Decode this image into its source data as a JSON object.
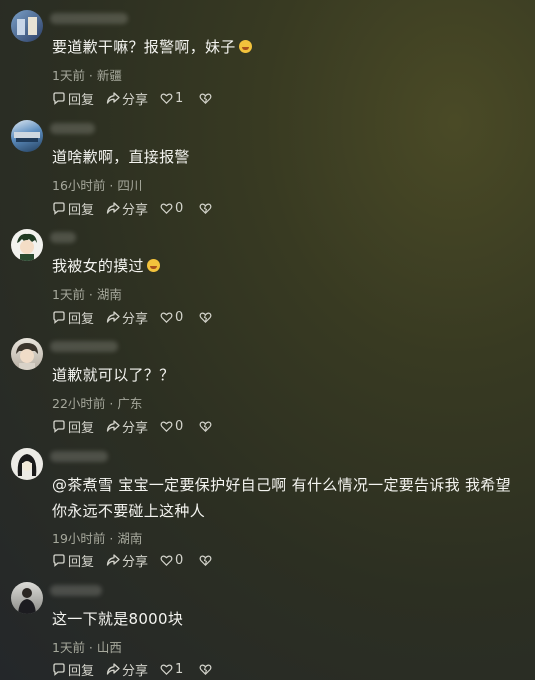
{
  "comments": [
    {
      "text": "要道歉干嘛？报警啊，妹子",
      "emoji": "laughing-emoji",
      "meta": "1天前 · 新疆",
      "reply": "回复",
      "share": "分享",
      "likes": "1"
    },
    {
      "text": "道啥歉啊，直接报警",
      "meta": "16小时前 · 四川",
      "reply": "回复",
      "share": "分享",
      "likes": "0"
    },
    {
      "text": "我被女的摸过",
      "emoji": "tongue-emoji",
      "meta": "1天前 · 湖南",
      "reply": "回复",
      "share": "分享",
      "likes": "0"
    },
    {
      "text": "道歉就可以了？？",
      "meta": "22小时前 · 广东",
      "reply": "回复",
      "share": "分享",
      "likes": "0"
    },
    {
      "text": "@茶煮雪 宝宝一定要保护好自己啊 有什么情况一定要告诉我 我希望你永远不要碰上这种人",
      "meta": "19小时前 · 湖南",
      "reply": "回复",
      "share": "分享",
      "likes": "0"
    },
    {
      "text": "这一下就是8000块",
      "meta": "1天前 · 山西",
      "reply": "回复",
      "share": "分享",
      "likes": "1"
    }
  ],
  "icons": {
    "reply": "comment-bubble-icon",
    "share": "share-arrow-icon",
    "like": "heart-icon",
    "dislike": "broken-heart-icon"
  }
}
